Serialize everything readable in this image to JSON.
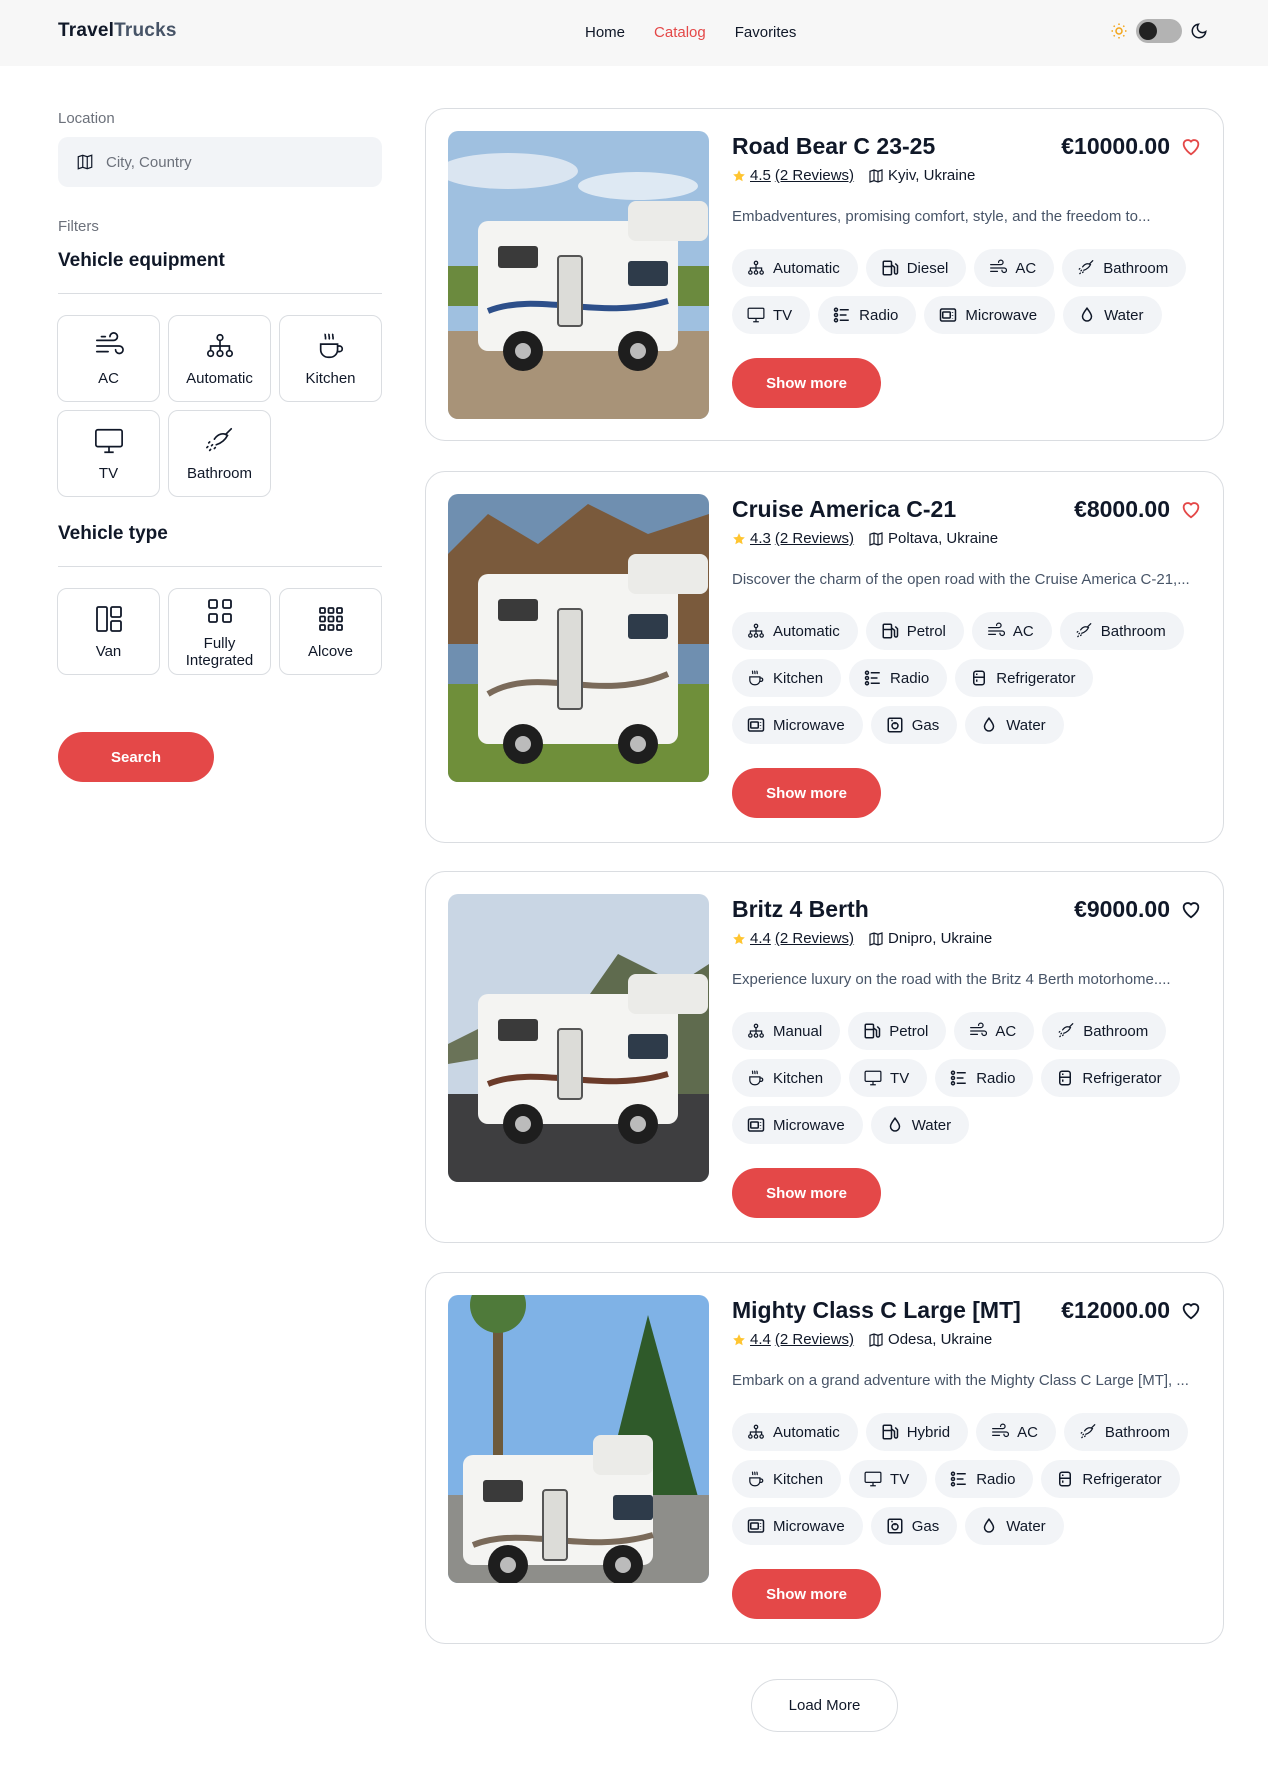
{
  "header": {
    "logo_bold": "Travel",
    "logo_rest": "Trucks",
    "nav": [
      "Home",
      "Catalog",
      "Favorites"
    ],
    "active_nav": "Catalog"
  },
  "sidebar": {
    "location_label": "Location",
    "location_placeholder": "City, Country",
    "filters_label": "Filters",
    "equipment_title": "Vehicle equipment",
    "equipment": [
      {
        "label": "AC",
        "icon": "wind-icon"
      },
      {
        "label": "Automatic",
        "icon": "transmission-icon"
      },
      {
        "label": "Kitchen",
        "icon": "cup-icon"
      },
      {
        "label": "TV",
        "icon": "tv-icon"
      },
      {
        "label": "Bathroom",
        "icon": "shower-icon"
      }
    ],
    "type_title": "Vehicle type",
    "types": [
      {
        "label": "Van",
        "icon": "van-layout-icon"
      },
      {
        "label": "Fully Integrated",
        "icon": "grid-4-icon"
      },
      {
        "label": "Alcove",
        "icon": "grid-9-icon"
      }
    ],
    "search_label": "Search"
  },
  "colors": {
    "accent": "#e44848",
    "chip_bg": "#f2f4f7",
    "star": "#ffc531",
    "border": "#dadde1"
  },
  "campers": [
    {
      "name": "Road Bear C 23-25",
      "price": "€10000.00",
      "favorite": true,
      "rating": "4.5",
      "reviews": "(2 Reviews)",
      "location": "Kyiv, Ukraine",
      "description": "Embadventures, promising comfort, style, and the freedom to...",
      "features": [
        "Automatic",
        "Diesel",
        "AC",
        "Bathroom",
        "TV",
        "Radio",
        "Microwave",
        "Water"
      ],
      "button": "Show more"
    },
    {
      "name": "Cruise America C-21",
      "price": "€8000.00",
      "favorite": true,
      "rating": "4.3",
      "reviews": "(2 Reviews)",
      "location": "Poltava, Ukraine",
      "description": "Discover the charm of the open road with the Cruise America C-21,...",
      "features": [
        "Automatic",
        "Petrol",
        "AC",
        "Bathroom",
        "Kitchen",
        "Radio",
        "Refrigerator",
        "Microwave",
        "Gas",
        "Water"
      ],
      "button": "Show more"
    },
    {
      "name": "Britz 4 Berth",
      "price": "€9000.00",
      "favorite": false,
      "rating": "4.4",
      "reviews": "(2 Reviews)",
      "location": "Dnipro, Ukraine",
      "description": "Experience luxury on the road with the Britz 4 Berth motorhome....",
      "features": [
        "Manual",
        "Petrol",
        "AC",
        "Bathroom",
        "Kitchen",
        "TV",
        "Radio",
        "Refrigerator",
        "Microwave",
        "Water"
      ],
      "button": "Show more"
    },
    {
      "name": "Mighty Class C Large [MT]",
      "price": "€12000.00",
      "favorite": false,
      "rating": "4.4",
      "reviews": "(2 Reviews)",
      "location": "Odesa, Ukraine",
      "description": "Embark on a grand adventure with the Mighty Class C Large [MT], ...",
      "features": [
        "Automatic",
        "Hybrid",
        "AC",
        "Bathroom",
        "Kitchen",
        "TV",
        "Radio",
        "Refrigerator",
        "Microwave",
        "Gas",
        "Water"
      ],
      "button": "Show more"
    }
  ],
  "load_more": "Load More"
}
